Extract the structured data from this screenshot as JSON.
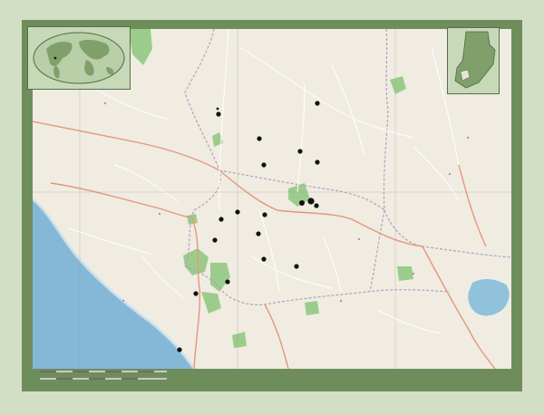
{
  "map": {
    "region_type": "open-street-map-style administrative map",
    "colors": {
      "frame_background": "#d2dfc5",
      "border_band": "#6f8d5b",
      "land": "#f0ece2",
      "water": "#8fc0d8",
      "sea": "#84b8d6",
      "lake": "#90c2dc",
      "green_areas": "#9ccc8c",
      "roads_major": "#e5967e",
      "roads_minor": "#ffffff",
      "admin_boundary": "#b39fc2",
      "markers": "#111111"
    },
    "insets": {
      "world_map": {
        "shown": true
      },
      "country_locator": {
        "shown": true
      }
    },
    "markers_count": 20,
    "tick_labels": {
      "top": [
        "",
        "",
        "",
        ""
      ],
      "left": [
        "",
        ""
      ]
    }
  }
}
